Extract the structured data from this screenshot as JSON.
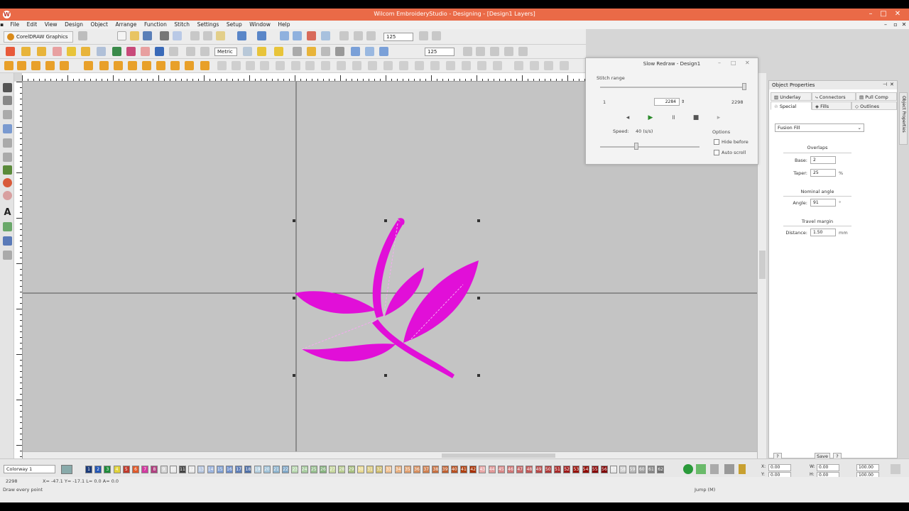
{
  "window": {
    "title": "Wilcom EmbroideryStudio - Designing - [Design1          Layers]",
    "app_icon": "wilcom-logo-icon"
  },
  "menu": [
    "File",
    "Edit",
    "View",
    "Design",
    "Object",
    "Arrange",
    "Function",
    "Stitch",
    "Settings",
    "Setup",
    "Window",
    "Help"
  ],
  "toolbar": {
    "corel_button": "CorelDRAW Graphics",
    "zoom_value": "125",
    "units_value": "Metric",
    "zoom_value2": "125"
  },
  "slow_redraw": {
    "title": "Slow Redraw - Design1",
    "stitch_range_label": "Stitch range",
    "start_value": "1",
    "current_value": "2284",
    "end_value": "2298",
    "speed_label": "Speed:",
    "speed_value": "40 (s/s)",
    "options_label": "Options",
    "hide_before_label": "Hide before",
    "auto_scroll_label": "Auto scroll"
  },
  "object_properties": {
    "title": "Object Properties",
    "tabs_row1": [
      "Underlay",
      "Connectors",
      "Pull Comp"
    ],
    "tabs_row2": [
      "Special",
      "Fills",
      "Outlines"
    ],
    "fill_type": "Fusion Fill",
    "overlaps_header": "Overlaps",
    "fields": [
      {
        "label": "Base:",
        "value": "2",
        "unit": ""
      },
      {
        "label": "Taper:",
        "value": "25",
        "unit": "%"
      }
    ],
    "nominal_angle_header": "Nominal angle",
    "angle": {
      "label": "Angle:",
      "value": "91",
      "unit": "°"
    },
    "travel_margin_header": "Travel margin",
    "distance": {
      "label": "Distance:",
      "value": "1.50",
      "unit": "mm"
    },
    "bottom_buttons": [
      "?",
      "Save",
      "?"
    ]
  },
  "bottom": {
    "colorway": "Colorway 1",
    "chips": [
      "1",
      "2",
      "3",
      "4",
      "5",
      "6",
      "7",
      "8",
      "9",
      "10",
      "11",
      "12",
      "13",
      "14",
      "15",
      "16",
      "17",
      "18",
      "19",
      "20",
      "21",
      "22",
      "23",
      "24",
      "25",
      "26",
      "27",
      "28",
      "29",
      "30",
      "31",
      "32",
      "33",
      "34",
      "35",
      "36",
      "37",
      "38",
      "39",
      "40",
      "41",
      "42",
      "43",
      "44",
      "45",
      "46",
      "47",
      "48",
      "49",
      "50",
      "51",
      "52",
      "53",
      "54",
      "55",
      "56",
      "57",
      "58",
      "59",
      "60",
      "61",
      "62"
    ],
    "chip_colors": [
      "#1a3a7a",
      "#2457b5",
      "#1f8b3a",
      "#e0d23a",
      "#c0392b",
      "#e05a2b",
      "#d23aa0",
      "#b04080",
      "#d8d8d8",
      "#e8e8e8",
      "#444444",
      "#e8e8e8",
      "#b7c7e0",
      "#9db5de",
      "#7f9fd2",
      "#6e8fcb",
      "#5f7fb9",
      "#4f70a8",
      "#b6d0e0",
      "#a0c2d8",
      "#90b6d0",
      "#80a8c8",
      "#b8d8b0",
      "#a8cca0",
      "#98c090",
      "#88b480",
      "#c8d8a0",
      "#b8cc90",
      "#a8c080",
      "#e8d890",
      "#dccb80",
      "#d0be70",
      "#f0c090",
      "#e8b080",
      "#e0a070",
      "#d89060",
      "#d08050",
      "#c87040",
      "#c06030",
      "#b85020",
      "#b04010",
      "#a83000",
      "#e8a8a8",
      "#e09898",
      "#d88888",
      "#d07878",
      "#c86868",
      "#c05858",
      "#b84848",
      "#b03838",
      "#a82828",
      "#a01818",
      "#981008",
      "#900800",
      "#880000",
      "#800000",
      "#e8e8e8",
      "#d0d0d0",
      "#b8b8b8",
      "#a0a0a0",
      "#888888",
      "#707070"
    ],
    "coords": [
      {
        "label": "X:",
        "value": "0.00"
      },
      {
        "label": "Y:",
        "value": "0.00"
      },
      {
        "label": "W:",
        "value": "0.00"
      },
      {
        "label": "H:",
        "value": "0.00"
      },
      {
        "label": "",
        "value": "100.00"
      },
      {
        "label": "",
        "value": "100.00"
      }
    ]
  },
  "status": {
    "stitch_count": "2298",
    "position": "X= -47.1 Y= -17.1 L= 0.0 A= 0.0",
    "hint": "Draw every point",
    "mode": "Jump (M)"
  }
}
